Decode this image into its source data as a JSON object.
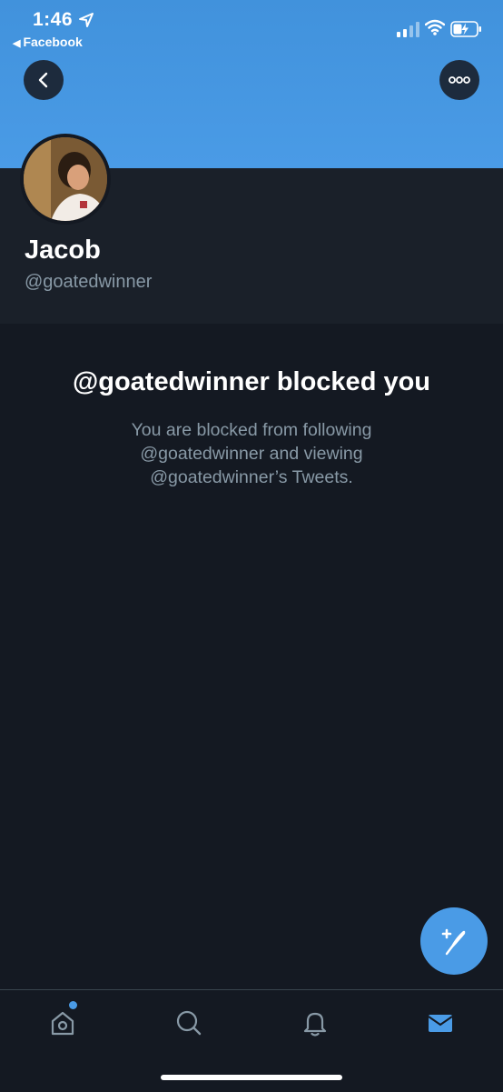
{
  "status_bar": {
    "time": "1:46",
    "back_app_label": "Facebook"
  },
  "header": {
    "back_icon": "chevron-left-icon",
    "more_icon": "more-dots-icon"
  },
  "profile": {
    "name": "Jacob",
    "handle": "@goatedwinner"
  },
  "blocked": {
    "title": "@goatedwinner blocked you",
    "description": "You are blocked from following @goatedwinner and viewing @goatedwinner’s Tweets."
  },
  "fab": {
    "icon": "compose-tweet-icon"
  },
  "tabbar": {
    "items": [
      {
        "name": "home",
        "icon": "home-icon",
        "badge": true
      },
      {
        "name": "search",
        "icon": "search-icon"
      },
      {
        "name": "notifications",
        "icon": "bell-icon"
      },
      {
        "name": "messages",
        "icon": "mail-icon",
        "active": true
      }
    ]
  },
  "colors": {
    "accent": "#4a9be6",
    "background": "#141922",
    "secondary_text": "#8899a6"
  }
}
